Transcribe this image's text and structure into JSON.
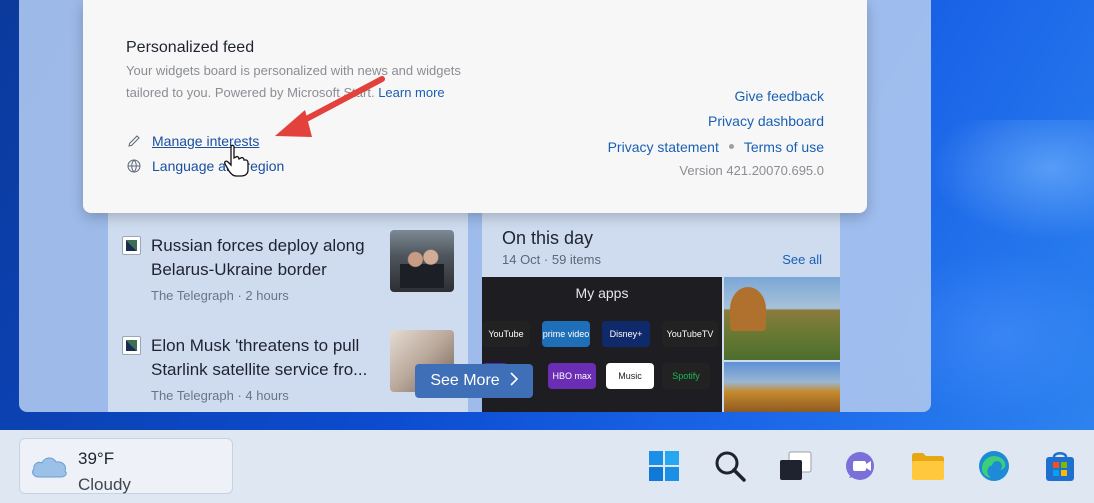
{
  "flyout": {
    "title": "Personalized feed",
    "description_part1": "Your widgets board is personalized with news and widgets tailored to you. Powered by Microsoft Start.",
    "learn_more": "Learn more",
    "manage_interests": "Manage interests",
    "language_region": "Language and region",
    "give_feedback": "Give feedback",
    "privacy_dashboard": "Privacy dashboard",
    "privacy_statement": "Privacy statement",
    "terms_of_use": "Terms of use",
    "version": "Version 421.20070.695.0"
  },
  "news": [
    {
      "headline": "Russian forces deploy along Belarus-Ukraine border",
      "meta": "The Telegraph · 2 hours"
    },
    {
      "headline": "Elon Musk 'threatens to pull Starlink satellite service fro...",
      "meta": "The Telegraph · 4 hours"
    }
  ],
  "on_this_day": {
    "title": "On this day",
    "subtitle": "14 Oct · 59 items",
    "see_all": "See all",
    "my_apps": "My apps",
    "apps": [
      "YouTube",
      "prime video",
      "Disney+",
      "YouTubeTV",
      "HBO max",
      "Music",
      "Spotify"
    ]
  },
  "see_more": "See More",
  "taskbar": {
    "temperature": "39°F",
    "condition": "Cloudy",
    "icons": [
      "start-icon",
      "search-icon",
      "task-view-icon",
      "chat-icon",
      "file-explorer-icon",
      "edge-icon",
      "store-icon"
    ]
  },
  "colors": {
    "accent_link": "#1a5fb4",
    "annotation_red": "#e2413c"
  }
}
